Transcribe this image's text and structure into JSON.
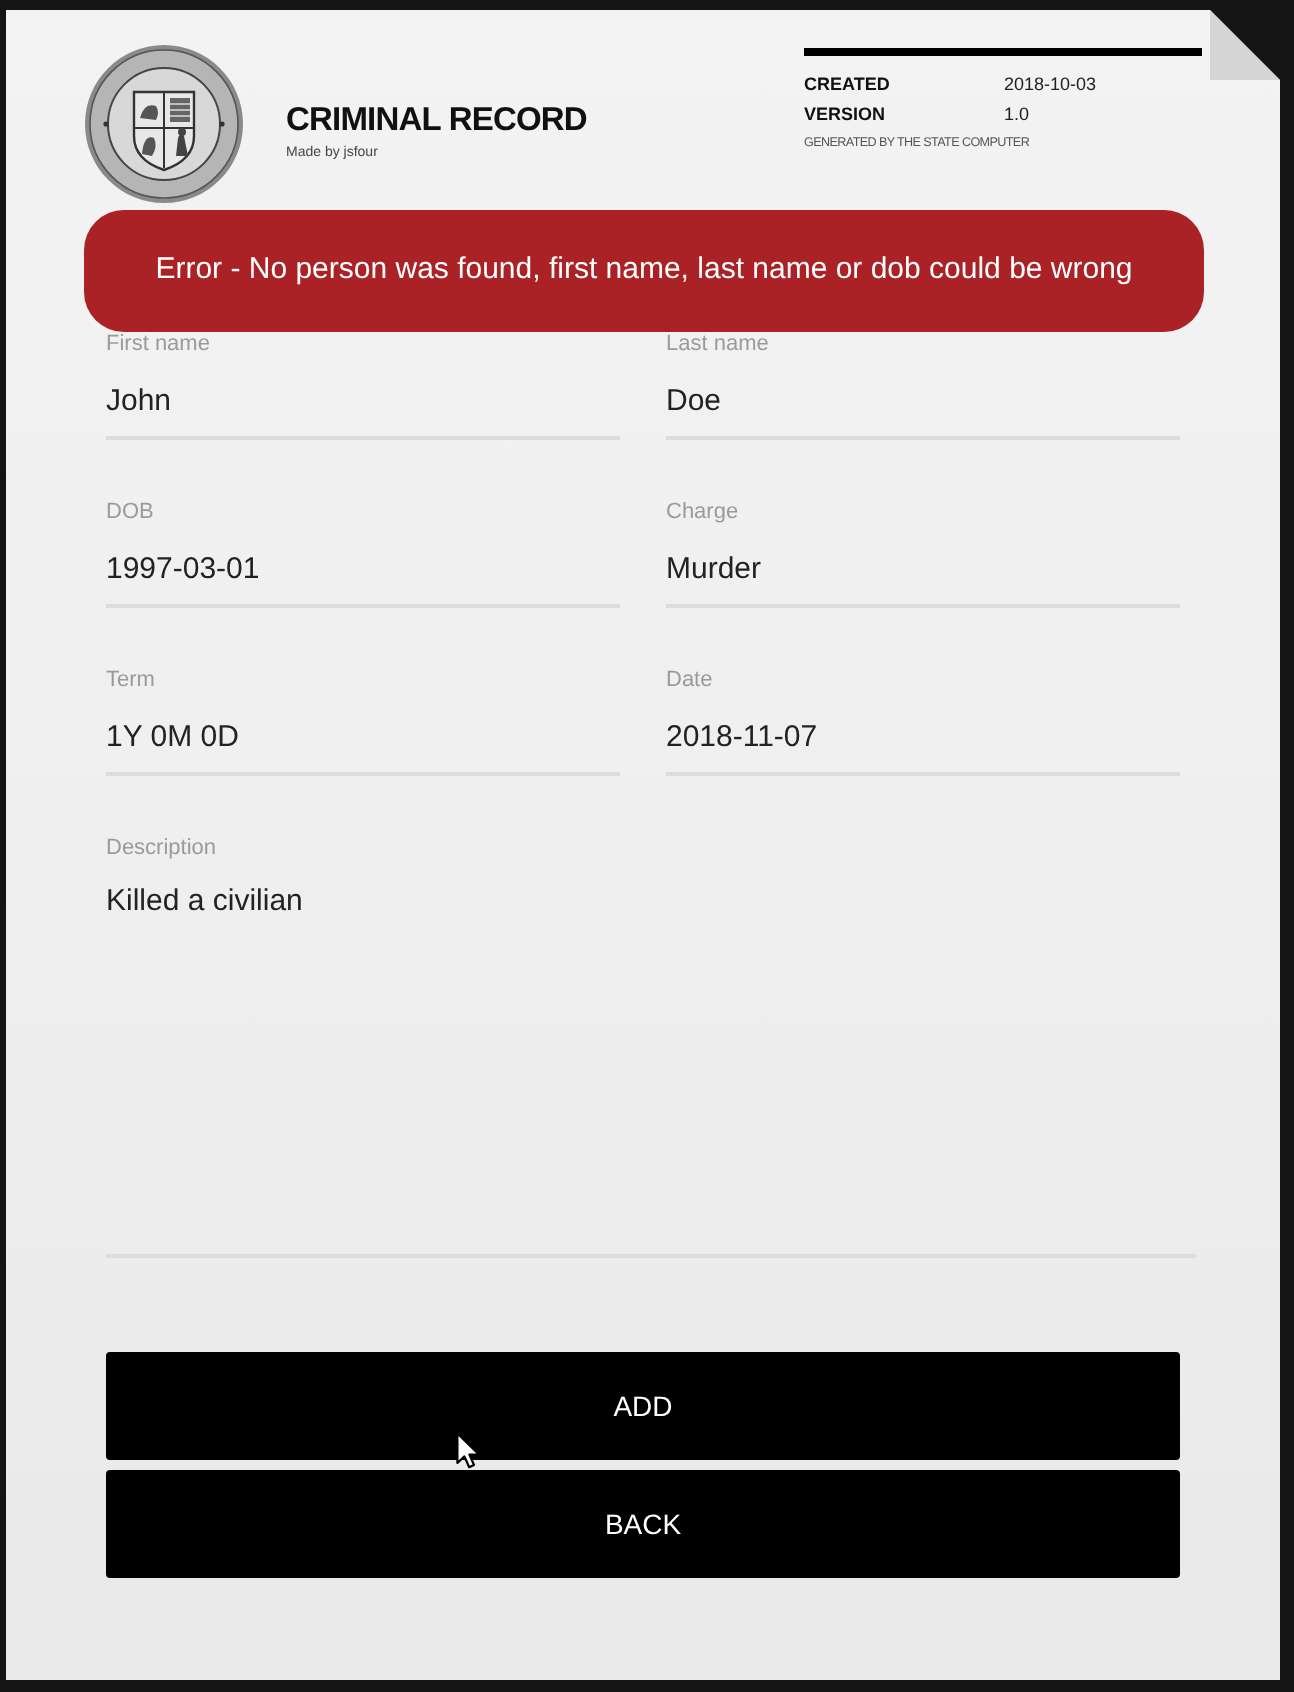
{
  "header": {
    "title": "CRIMINAL RECORD",
    "subtitle": "Made by jsfour"
  },
  "meta": {
    "rows": [
      {
        "label": "CREATED",
        "value": "2018-10-03"
      },
      {
        "label": "VERSION",
        "value": "1.0"
      }
    ],
    "note": "GENERATED BY THE STATE COMPUTER"
  },
  "error": {
    "message": "Error - No person was found, first name, last name or dob could be wrong"
  },
  "fields": [
    {
      "label": "First name",
      "value": "John"
    },
    {
      "label": "Last name",
      "value": "Doe"
    },
    {
      "label": "DOB",
      "value": "1997-03-01"
    },
    {
      "label": "Charge",
      "value": "Murder"
    },
    {
      "label": "Term",
      "value": "1Y 0M 0D"
    },
    {
      "label": "Date",
      "value": "2018-11-07"
    }
  ],
  "description": {
    "label": "Description",
    "value": "Killed a civilian"
  },
  "buttons": [
    {
      "label": "ADD"
    },
    {
      "label": "BACK"
    }
  ]
}
